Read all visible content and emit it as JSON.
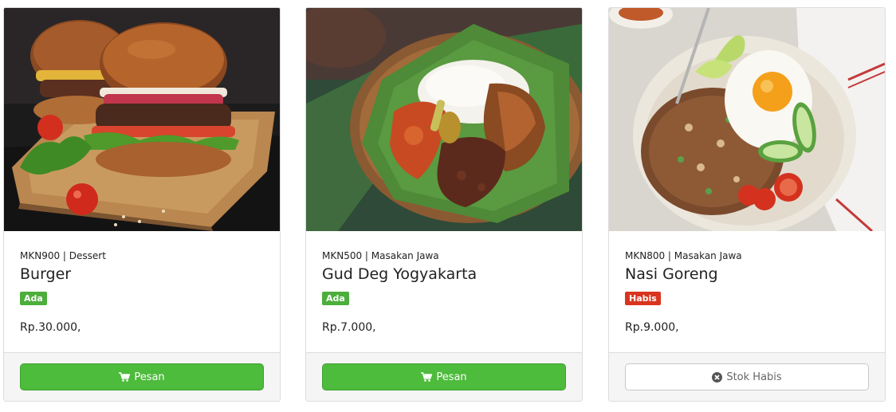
{
  "menu": {
    "items": [
      {
        "code": "MKN900",
        "category": "Dessert",
        "meta": "MKN900 | Dessert",
        "name": "Burger",
        "status": "Ada",
        "price": "Rp.30.000,",
        "button_label": "Pesan",
        "button_icon": "cart-icon",
        "photo": "burger-photo"
      },
      {
        "code": "MKN500",
        "category": "Masakan Jawa",
        "meta": "MKN500 | Masakan Jawa",
        "name": "Gud Deg Yogyakarta",
        "status": "Ada",
        "price": "Rp.7.000,",
        "button_label": "Pesan",
        "button_icon": "cart-icon",
        "photo": "gudeg-photo"
      },
      {
        "code": "MKN800",
        "category": "Masakan Jawa",
        "meta": "MKN800 | Masakan Jawa",
        "name": "Nasi Goreng",
        "status": "Habis",
        "price": "Rp.9.000,",
        "button_label": "Stok Habis",
        "button_icon": "times-circle-icon",
        "photo": "nasi-goreng-photo"
      }
    ]
  },
  "colors": {
    "available": "#4cae3b",
    "sold_out": "#d9341e",
    "order_button": "#4dbb3b"
  }
}
